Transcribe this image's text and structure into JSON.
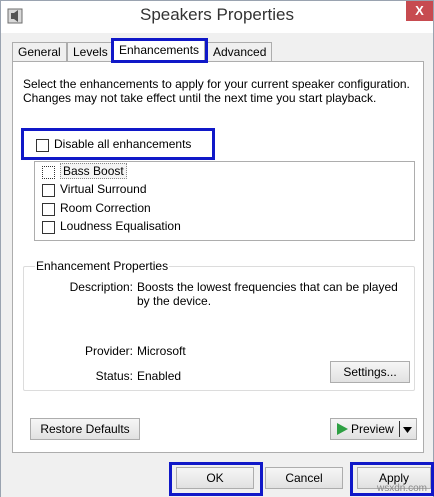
{
  "window": {
    "title": "Speakers Properties",
    "close_glyph": "X"
  },
  "tabs": [
    {
      "label": "General"
    },
    {
      "label": "Levels"
    },
    {
      "label": "Enhancements"
    },
    {
      "label": "Advanced"
    }
  ],
  "description": "Select the enhancements to apply for your current speaker configuration. Changes may not take effect until the next time you start playback.",
  "disable_all": {
    "label": "Disable all enhancements",
    "checked": false
  },
  "enhancements": [
    {
      "label": "Bass Boost",
      "checked": false,
      "selected": true
    },
    {
      "label": "Virtual Surround",
      "checked": false
    },
    {
      "label": "Room Correction",
      "checked": false
    },
    {
      "label": "Loudness Equalisation",
      "checked": false
    }
  ],
  "properties": {
    "group_title": "Enhancement Properties",
    "description_label": "Description:",
    "description_value": "Boosts the lowest frequencies that can be played by the device.",
    "provider_label": "Provider:",
    "provider_value": "Microsoft",
    "status_label": "Status:",
    "status_value": "Enabled",
    "settings_button": "Settings..."
  },
  "buttons": {
    "restore_defaults": "Restore Defaults",
    "preview": "Preview",
    "ok": "OK",
    "cancel": "Cancel",
    "apply": "Apply"
  },
  "watermark": "wsxdn.com",
  "colors": {
    "highlight": "#1018c8",
    "close": "#c74b50",
    "play": "#2ea043"
  }
}
